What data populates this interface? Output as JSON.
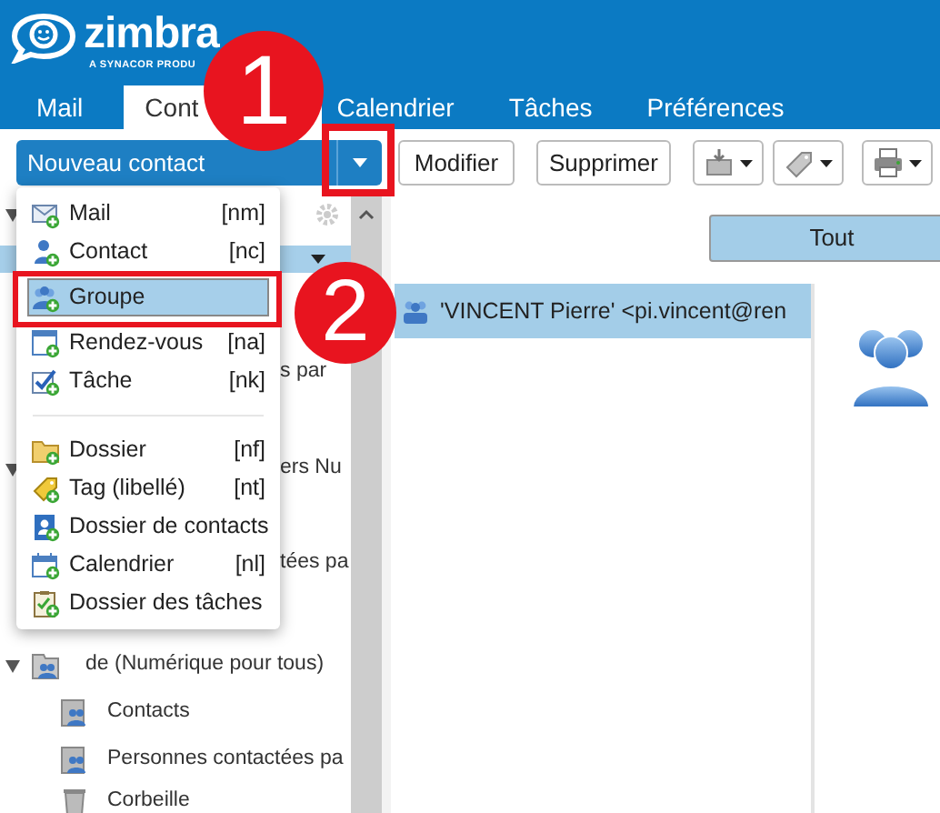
{
  "header": {
    "logo": "zimbra",
    "tagline": "A SYNACOR PRODU"
  },
  "tabs": [
    {
      "label": "Mail",
      "selected": false
    },
    {
      "label": "Cont",
      "selected": true
    },
    {
      "label": "Calendrier",
      "selected": false
    },
    {
      "label": "Tâches",
      "selected": false
    },
    {
      "label": "Préférences",
      "selected": false
    }
  ],
  "toolbar": {
    "new_button": "Nouveau contact",
    "buttons": [
      "Modifier",
      "Supprimer"
    ]
  },
  "new_menu": [
    {
      "kind": "item",
      "label": "Mail",
      "shortcut": "[nm]",
      "selected": false
    },
    {
      "kind": "item",
      "label": "Contact",
      "shortcut": "[nc]",
      "selected": false
    },
    {
      "kind": "item",
      "label": "Groupe",
      "selected": true
    },
    {
      "kind": "item",
      "label": "Rendez-vous",
      "shortcut": "[na]",
      "selected": false
    },
    {
      "kind": "item",
      "label": "Tâche",
      "shortcut": "[nk]",
      "selected": false
    },
    {
      "kind": "separator"
    },
    {
      "kind": "item",
      "label": "Dossier",
      "shortcut": "[nf]",
      "selected": false
    },
    {
      "kind": "item",
      "label": "Tag (libellé)",
      "shortcut": "[nt]",
      "selected": false
    },
    {
      "kind": "item",
      "label": "Dossier de contacts",
      "selected": false
    },
    {
      "kind": "item",
      "label": "Calendrier",
      "shortcut": "[nl]",
      "selected": false
    },
    {
      "kind": "item",
      "label": "Dossier des tâches",
      "selected": false
    }
  ],
  "tree": [
    {
      "kind": "header",
      "expanded": true
    },
    {
      "kind": "selected_row",
      "selected": true
    },
    {
      "kind": "fragment",
      "text": "s par"
    },
    {
      "kind": "fragment",
      "text": "ers Nu",
      "expanded": true
    },
    {
      "kind": "fragment",
      "text": "tées pa"
    },
    {
      "kind": "account",
      "text": "de (Numérique pour tous)",
      "expanded": true
    },
    {
      "kind": "addressbook",
      "text": "Contacts"
    },
    {
      "kind": "addressbook",
      "text": "Personnes contactées pa"
    },
    {
      "kind": "trash",
      "text": "Corbeille"
    }
  ],
  "filter_button": "Tout",
  "contacts": [
    {
      "text": "'VINCENT Pierre' <pi.vincent@ren",
      "selected": true
    }
  ],
  "callouts": [
    "1",
    "2"
  ]
}
